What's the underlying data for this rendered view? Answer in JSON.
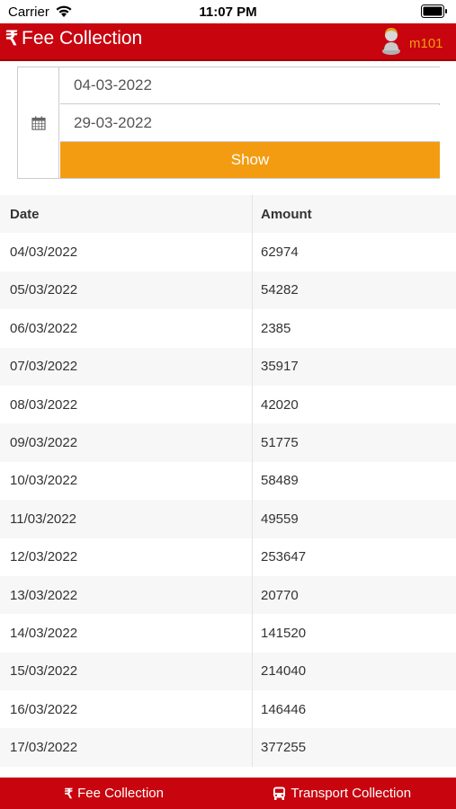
{
  "status_bar": {
    "carrier": "Carrier",
    "time": "11:07 PM"
  },
  "header": {
    "rupee_symbol": "₹",
    "title": "Fee Collection",
    "user": "m101"
  },
  "filter": {
    "from_date": "04-03-2022",
    "to_date": "29-03-2022",
    "show_label": "Show"
  },
  "table": {
    "columns": [
      "Date",
      "Amount"
    ],
    "rows": [
      [
        "04/03/2022",
        "62974"
      ],
      [
        "05/03/2022",
        "54282"
      ],
      [
        "06/03/2022",
        "2385"
      ],
      [
        "07/03/2022",
        "35917"
      ],
      [
        "08/03/2022",
        "42020"
      ],
      [
        "09/03/2022",
        "51775"
      ],
      [
        "10/03/2022",
        "58489"
      ],
      [
        "11/03/2022",
        "49559"
      ],
      [
        "12/03/2022",
        "253647"
      ],
      [
        "13/03/2022",
        "20770"
      ],
      [
        "14/03/2022",
        "141520"
      ],
      [
        "15/03/2022",
        "214040"
      ],
      [
        "16/03/2022",
        "146446"
      ],
      [
        "17/03/2022",
        "377255"
      ]
    ]
  },
  "bottom_nav": {
    "rupee_symbol": "₹",
    "fee_collection": "Fee Collection",
    "transport_collection": "Transport Collection"
  },
  "colors": {
    "brand_red": "#c8040e",
    "accent_orange": "#f39c12"
  },
  "icons": [
    "wifi-icon",
    "battery-icon",
    "rupee-icon",
    "avatar",
    "calendar-icon",
    "bus-icon"
  ]
}
